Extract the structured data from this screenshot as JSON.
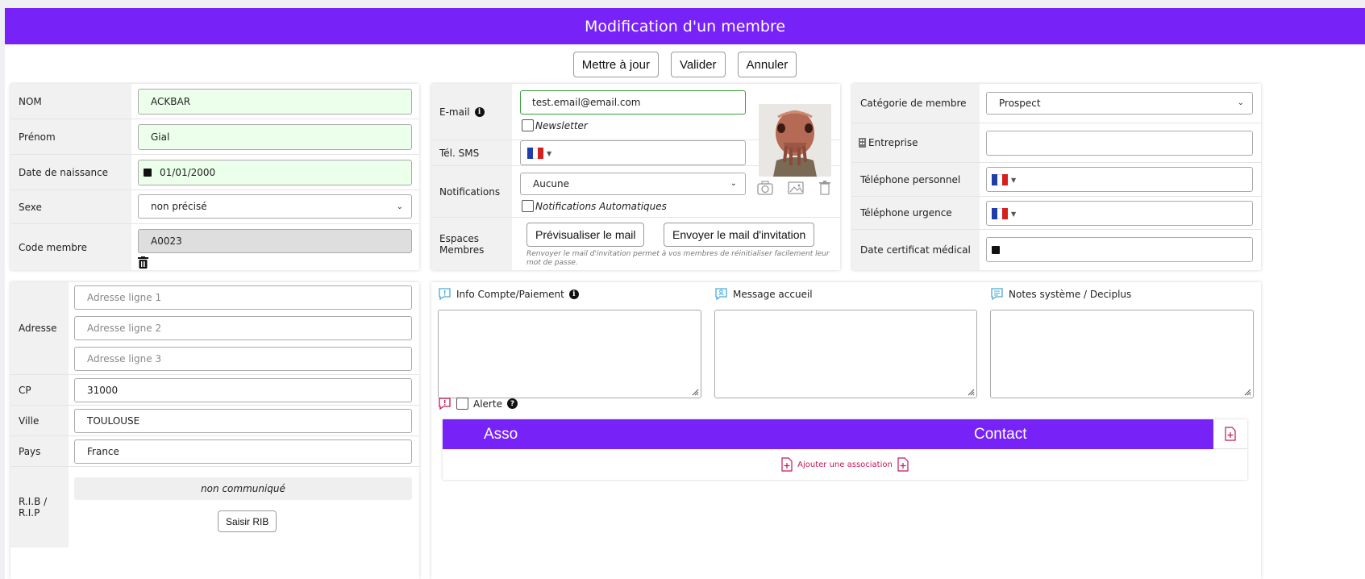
{
  "title": "Modification d'un membre",
  "actions": {
    "update": "Mettre à jour",
    "validate": "Valider",
    "cancel": "Annuler"
  },
  "identity": {
    "nom_label": "NOM",
    "nom_value": "ACKBAR",
    "prenom_label": "Prénom",
    "prenom_value": "Gial",
    "dob_label": "Date de naissance",
    "dob_value": "01/01/2000",
    "sexe_label": "Sexe",
    "sexe_value": "non précisé",
    "code_label": "Code membre",
    "code_value": "A0023"
  },
  "contact": {
    "email_label": "E-mail",
    "email_value": "test.email@email.com",
    "newsletter_label": "Newsletter",
    "sms_label": "Tél. SMS",
    "notif_label": "Notifications",
    "notif_value": "Aucune",
    "notif_auto_label": "Notifications Automatiques",
    "espaces_label": "Espaces Membres",
    "preview_button": "Prévisualiser le mail",
    "send_button": "Envoyer le mail d'invitation",
    "help_text": "Renvoyer le mail d'invitation permet à vos membres de réinitialiser facilement leur mot de passe."
  },
  "membership": {
    "categorie_label": "Catégorie de membre",
    "categorie_value": "Prospect",
    "entreprise_label": "Entreprise",
    "tel_perso_label": "Téléphone personnel",
    "tel_urgence_label": "Téléphone urgence",
    "certificat_label": "Date certificat médical"
  },
  "address": {
    "adresse_label": "Adresse",
    "line1_placeholder": "Adresse ligne 1",
    "line2_placeholder": "Adresse ligne 2",
    "line3_placeholder": "Adresse ligne 3",
    "cp_label": "CP",
    "cp_value": "31000",
    "ville_label": "Ville",
    "ville_value": "TOULOUSE",
    "pays_label": "Pays",
    "pays_value": "France",
    "rib_label": "R.I.B / R.I.P",
    "rib_value": "non communiqué",
    "rib_button": "Saisir RIB"
  },
  "notes": {
    "info_label": "Info Compte/Paiement",
    "accueil_label": "Message accueil",
    "systeme_label": "Notes système / Deciplus",
    "alerte_label": "Alerte"
  },
  "associations": {
    "col_asso": "Asso",
    "col_contact": "Contact",
    "add_label": "Ajouter une association"
  },
  "colors": {
    "accent": "#7722f7",
    "valid_field": "#ebffeb",
    "icon_blue": "#4aa9d8",
    "icon_red": "#c2185b"
  }
}
